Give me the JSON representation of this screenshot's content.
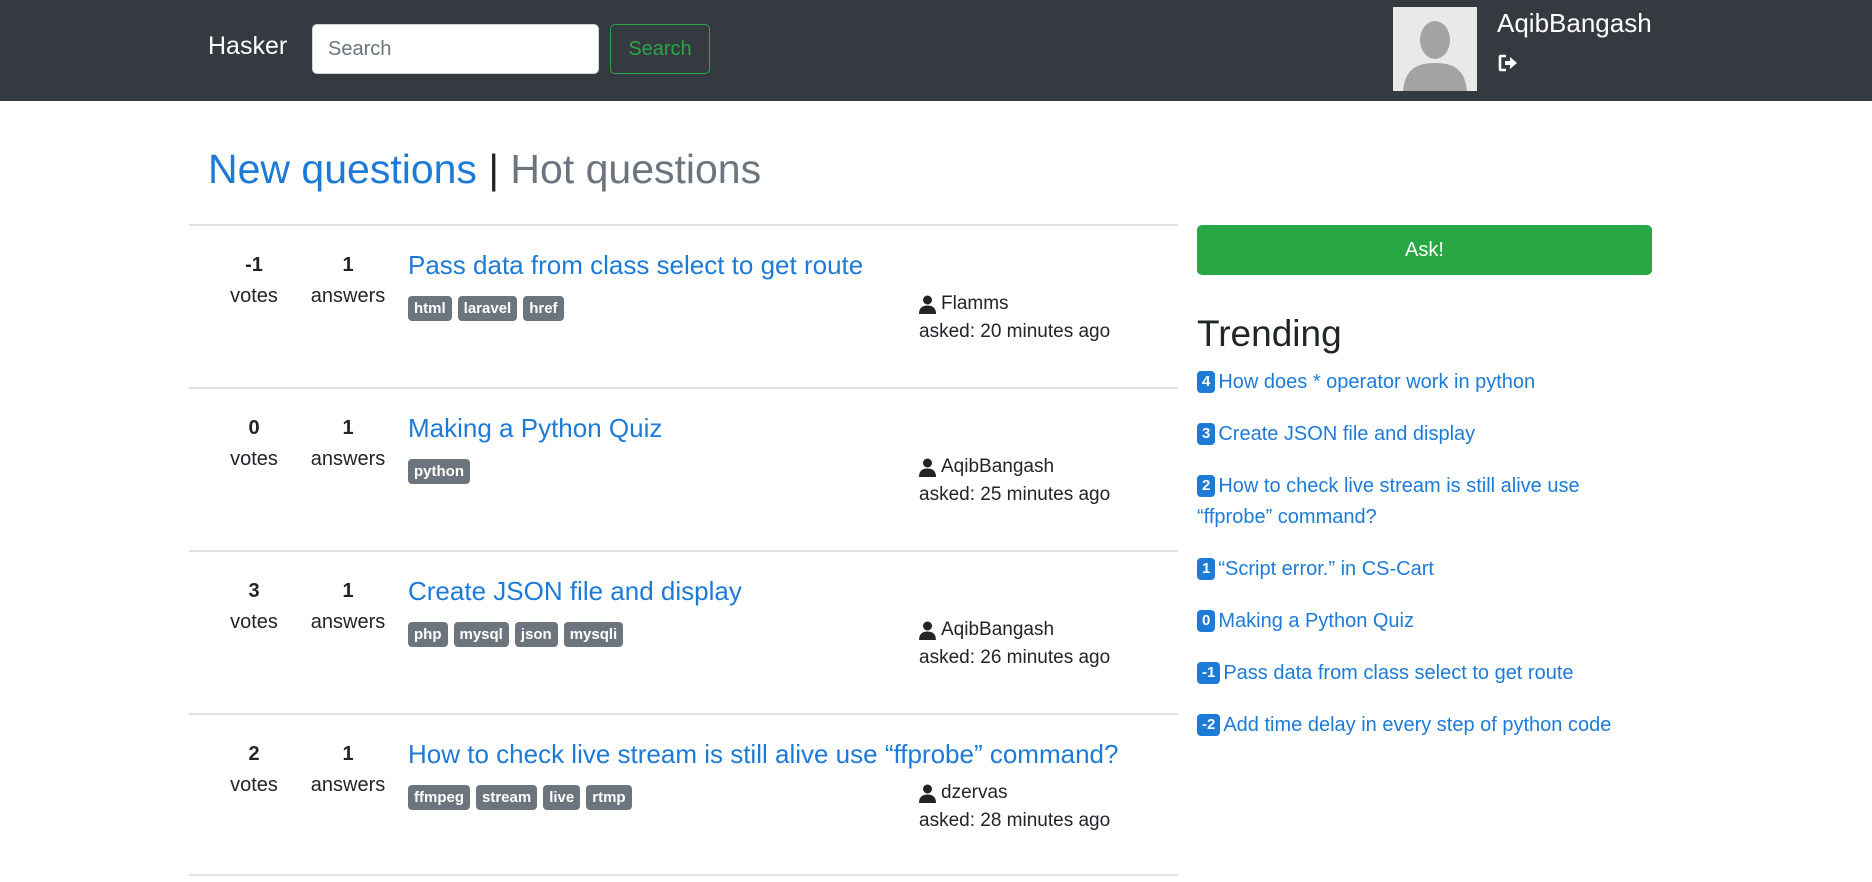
{
  "navbar": {
    "brand": "Hasker",
    "search_placeholder": "Search",
    "search_button": "Search",
    "username": "AqibBangash",
    "avatar_icon": "default-user-silhouette",
    "logout_icon": "sign-out-icon"
  },
  "tabs": {
    "new": "New questions",
    "separator": "|",
    "hot": "Hot questions"
  },
  "questions": [
    {
      "votes": "-1",
      "votes_label": "votes",
      "answers": "1",
      "answers_label": "answers",
      "title": "Pass data from class select to get route",
      "tags": [
        "html",
        "laravel",
        "href"
      ],
      "author": "Flamms",
      "asked": "asked: 20 minutes ago"
    },
    {
      "votes": "0",
      "votes_label": "votes",
      "answers": "1",
      "answers_label": "answers",
      "title": "Making a Python Quiz",
      "tags": [
        "python"
      ],
      "author": "AqibBangash",
      "asked": "asked: 25 minutes ago"
    },
    {
      "votes": "3",
      "votes_label": "votes",
      "answers": "1",
      "answers_label": "answers",
      "title": "Create JSON file and display",
      "tags": [
        "php",
        "mysql",
        "json",
        "mysqli"
      ],
      "author": "AqibBangash",
      "asked": "asked: 26 minutes ago"
    },
    {
      "votes": "2",
      "votes_label": "votes",
      "answers": "1",
      "answers_label": "answers",
      "title": "How to check live stream is still alive use “ffprobe” command?",
      "tags": [
        "ffmpeg",
        "stream",
        "live",
        "rtmp"
      ],
      "author": "dzervas",
      "asked": "asked: 28 minutes ago"
    }
  ],
  "sidebar": {
    "ask_button": "Ask!",
    "trending_title": "Trending",
    "trending": [
      {
        "score": "4",
        "title": "How does * operator work in python"
      },
      {
        "score": "3",
        "title": "Create JSON file and display"
      },
      {
        "score": "2",
        "title": "How to check live stream is still alive use “ffprobe” command?"
      },
      {
        "score": "1",
        "title": "“Script error.” in CS-Cart"
      },
      {
        "score": "0",
        "title": "Making a Python Quiz"
      },
      {
        "score": "-1",
        "title": "Pass data from class select to get route"
      },
      {
        "score": "-2",
        "title": "Add time delay in every step of python code"
      }
    ]
  },
  "colors": {
    "navbar": "#343a40",
    "link": "#1d7bd8",
    "success": "#28a745",
    "tag": "#6c757d"
  }
}
